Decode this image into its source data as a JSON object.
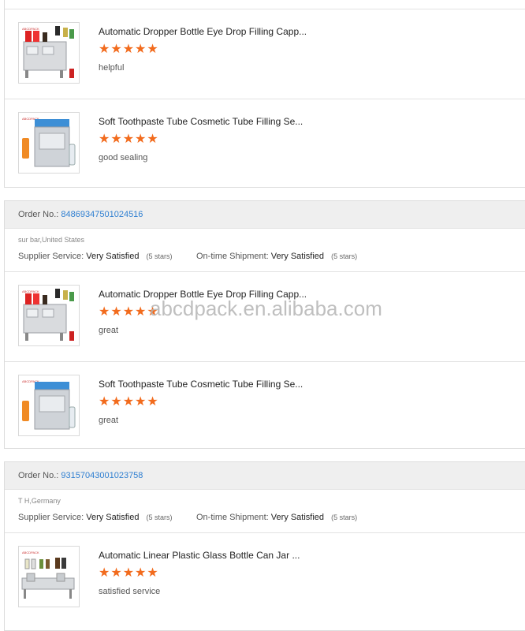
{
  "orders": [
    {
      "items": [
        {
          "title": "Automatic Dropper Bottle Eye Drop Filling Capp...",
          "stars": "★★★★★",
          "comment": "helpful",
          "image": "dropper-machine"
        },
        {
          "title": "Soft Toothpaste Tube Cosmetic Tube Filling Se...",
          "stars": "★★★★★",
          "comment": "good sealing",
          "image": "tube-machine"
        }
      ]
    },
    {
      "order_label": "Order No.:",
      "order_number": "84869347501024516",
      "location": "sur bar,United States",
      "supplier_label": "Supplier Service:",
      "supplier_value": "Very Satisfied",
      "supplier_stars": "(5 stars)",
      "shipment_label": "On-time Shipment:",
      "shipment_value": "Very Satisfied",
      "shipment_stars": "(5 stars)",
      "items": [
        {
          "title": "Automatic Dropper Bottle Eye Drop Filling Capp...",
          "stars": "★★★★★",
          "comment": "great",
          "image": "dropper-machine"
        },
        {
          "title": "Soft Toothpaste Tube Cosmetic Tube Filling Se...",
          "stars": "★★★★★",
          "comment": "great",
          "image": "tube-machine"
        }
      ]
    },
    {
      "order_label": "Order No.:",
      "order_number": "93157043001023758",
      "location": "T H,Germany",
      "supplier_label": "Supplier Service:",
      "supplier_value": "Very Satisfied",
      "supplier_stars": "(5 stars)",
      "shipment_label": "On-time Shipment:",
      "shipment_value": "Very Satisfied",
      "shipment_stars": "(5 stars)",
      "items": [
        {
          "title": "Automatic Linear Plastic Glass Bottle Can Jar ...",
          "stars": "★★★★★",
          "comment": "satisfied  service",
          "image": "linear-machine"
        }
      ]
    }
  ],
  "watermark": "abcdpack.en.alibaba.com",
  "colors": {
    "star": "#f26b1d",
    "order_number": "#2f7fd1",
    "header_bg": "#efefef"
  }
}
